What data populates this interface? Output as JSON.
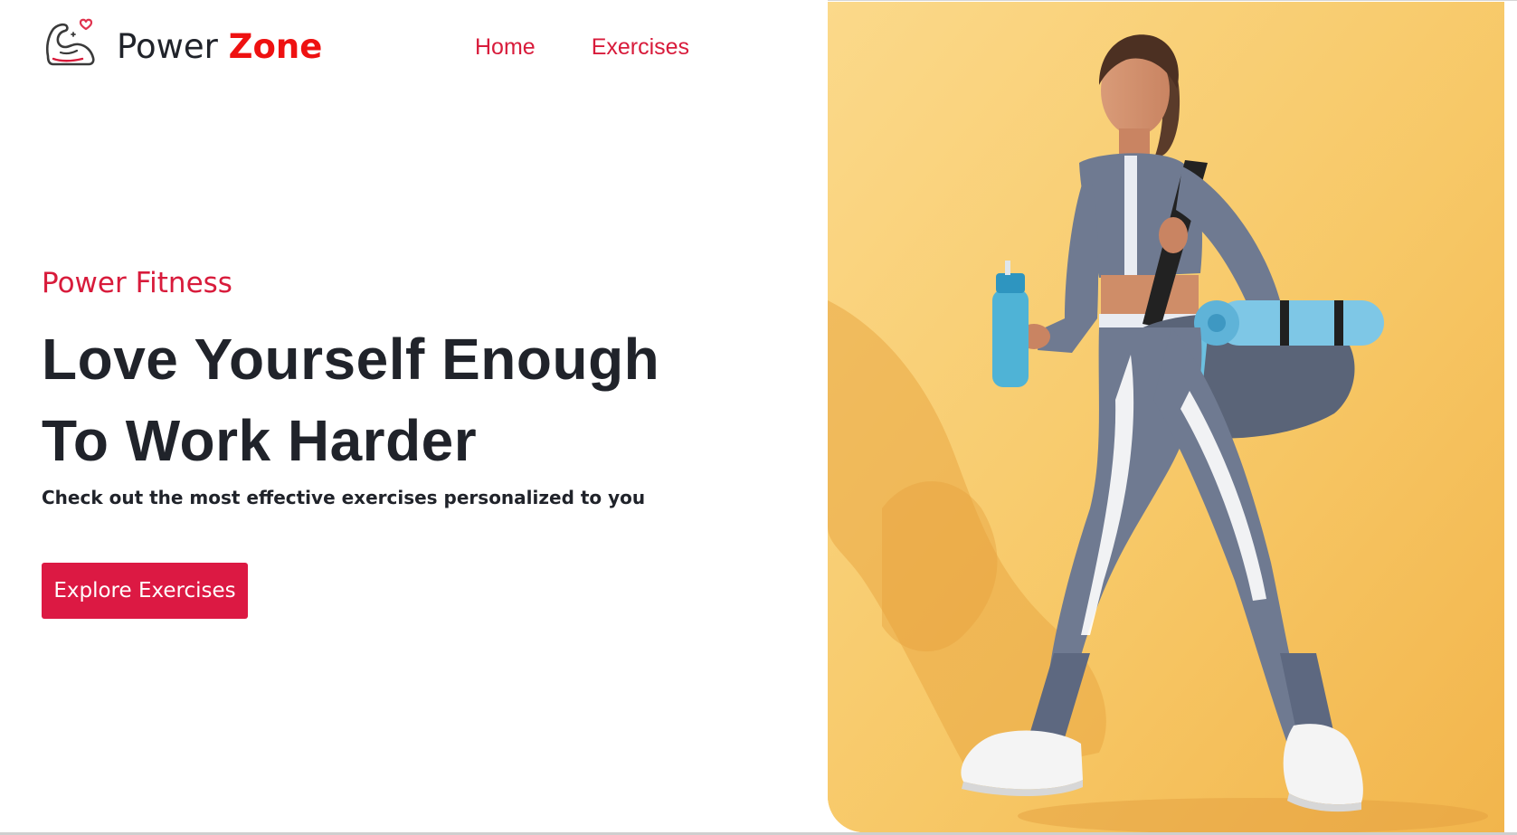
{
  "brand": {
    "name_first": "Power",
    "name_accent": "Zone",
    "logo_icon": "flexed-arm-heart-icon"
  },
  "nav": {
    "items": [
      {
        "label": "Home"
      },
      {
        "label": "Exercises"
      }
    ]
  },
  "hero": {
    "kicker": "Power Fitness",
    "headline_line1": "Love Yourself Enough",
    "headline_line2": "To Work Harder",
    "subtext": "Check out the most effective exercises personalized to you",
    "cta_label": "Explore Exercises",
    "image_description_icon": "woman-with-yoga-mat-and-shaker-photo"
  },
  "colors": {
    "accent": "#d81b3b",
    "brand_accent": "#ee1111",
    "button": "#dc1943",
    "text": "#20232a",
    "hero_background": "#f7c765"
  }
}
